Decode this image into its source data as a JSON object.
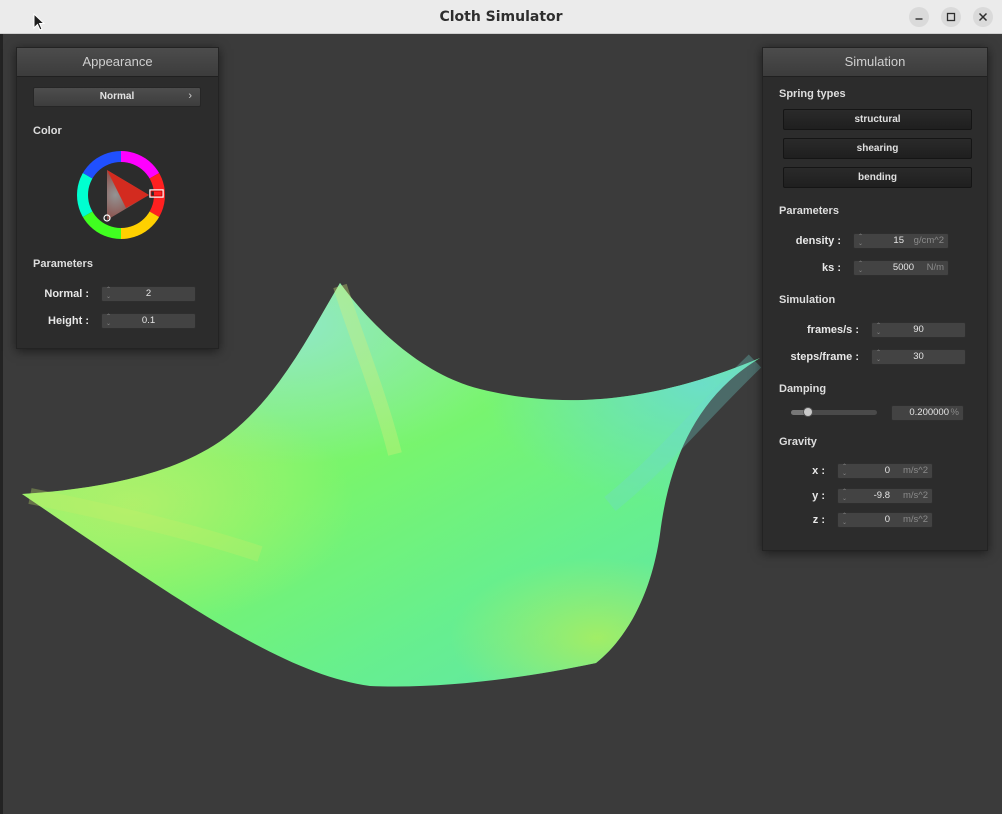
{
  "window": {
    "title": "Cloth Simulator"
  },
  "appearance": {
    "title": "Appearance",
    "shader": "Normal",
    "color_label": "Color",
    "parameters_label": "Parameters",
    "normal_label": "Normal :",
    "normal_value": "2",
    "height_label": "Height :",
    "height_value": "0.1"
  },
  "simulation": {
    "title": "Simulation",
    "spring_types_label": "Spring types",
    "spring_buttons": [
      "structural",
      "shearing",
      "bending"
    ],
    "parameters_label": "Parameters",
    "density_label": "density :",
    "density_value": "15",
    "density_unit": "g/cm^2",
    "ks_label": "ks :",
    "ks_value": "5000",
    "ks_unit": "N/m",
    "simulation_label": "Simulation",
    "fps_label": "frames/s :",
    "fps_value": "90",
    "steps_label": "steps/frame :",
    "steps_value": "30",
    "damping_label": "Damping",
    "damping_value": "0.200000",
    "damping_unit": "%",
    "damping_slider_fraction": 0.2,
    "gravity_label": "Gravity",
    "gx_label": "x :",
    "gx_value": "0",
    "gy_label": "y :",
    "gy_value": "-9.8",
    "gz_label": "z :",
    "gz_value": "0",
    "gravity_unit": "m/s^2"
  },
  "colors": {
    "cloth_primary": "#7cf56a",
    "cloth_secondary": "#5fe9a8",
    "panel_bg": "#2c2c2c",
    "viewport_bg": "#3b3b3b"
  },
  "icons": [
    "mouse-pointer-icon",
    "minimize-icon",
    "maximize-icon",
    "close-icon",
    "chevron-right-icon",
    "color-wheel-icon",
    "spinner-arrows-icon"
  ]
}
